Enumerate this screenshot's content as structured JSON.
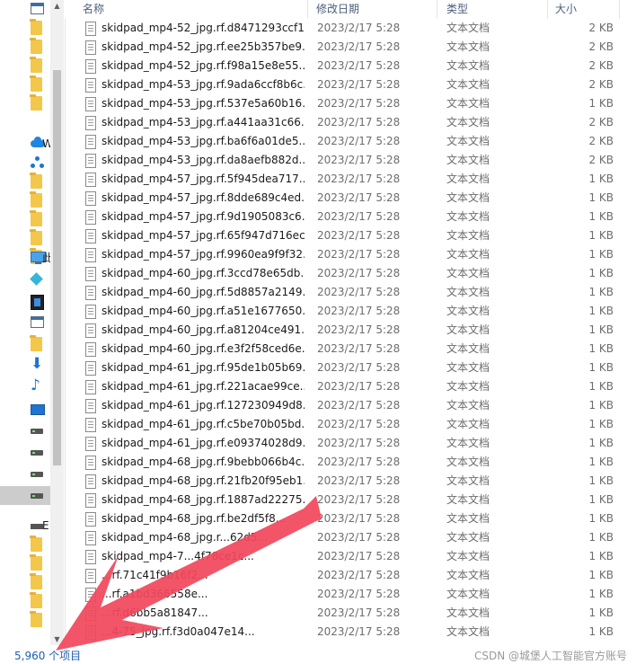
{
  "header": {
    "col_name": "名称",
    "col_date": "修改日期",
    "col_type": "类型",
    "col_size": "大小"
  },
  "nav": {
    "items": [
      {
        "icon": "window-icon",
        "label": ""
      },
      {
        "icon": "folder-icon",
        "label": ""
      },
      {
        "icon": "folder-icon",
        "label": ""
      },
      {
        "icon": "folder-icon",
        "label": ""
      },
      {
        "icon": "folder-icon",
        "label": ""
      },
      {
        "icon": "folder-icon",
        "label": ""
      },
      {
        "icon": "onedrive-icon",
        "label": "W"
      },
      {
        "icon": "network-nodes-icon",
        "label": ""
      },
      {
        "icon": "folder-icon",
        "label": ""
      },
      {
        "icon": "folder-icon",
        "label": ""
      },
      {
        "icon": "folder-icon",
        "label": ""
      },
      {
        "icon": "folder-icon",
        "label": ""
      },
      {
        "icon": "folder-icon",
        "label": ""
      },
      {
        "icon": "this-pc-icon",
        "label": "此"
      },
      {
        "icon": "3d-objects-icon",
        "label": ""
      },
      {
        "icon": "videos-icon",
        "label": ""
      },
      {
        "icon": "pictures-icon",
        "label": ""
      },
      {
        "icon": "documents-icon",
        "label": ""
      },
      {
        "icon": "downloads-icon",
        "label": ""
      },
      {
        "icon": "music-icon",
        "label": ""
      },
      {
        "icon": "desktop-icon",
        "label": ""
      },
      {
        "icon": "windows-drive-icon",
        "label": ""
      },
      {
        "icon": "drive-icon",
        "label": ""
      },
      {
        "icon": "drive-icon",
        "label": ""
      },
      {
        "icon": "drive-icon",
        "label": ""
      },
      {
        "icon": "spacer",
        "label": ""
      },
      {
        "icon": "network-drive-icon",
        "label": "E"
      },
      {
        "icon": "folder-icon",
        "label": ""
      },
      {
        "icon": "folder-icon",
        "label": ""
      },
      {
        "icon": "folder-icon",
        "label": ""
      },
      {
        "icon": "folder-icon",
        "label": ""
      },
      {
        "icon": "folder-icon",
        "label": ""
      }
    ]
  },
  "files": [
    {
      "name": "skidpad_mp4-52_jpg.rf.d8471293ccf1...",
      "date": "2023/2/17 5:28",
      "type": "文本文档",
      "size": "2 KB"
    },
    {
      "name": "skidpad_mp4-52_jpg.rf.ee25b357be9...",
      "date": "2023/2/17 5:28",
      "type": "文本文档",
      "size": "2 KB"
    },
    {
      "name": "skidpad_mp4-52_jpg.rf.f98a15e8e55...",
      "date": "2023/2/17 5:28",
      "type": "文本文档",
      "size": "2 KB"
    },
    {
      "name": "skidpad_mp4-53_jpg.rf.9ada6ccf8b6c...",
      "date": "2023/2/17 5:28",
      "type": "文本文档",
      "size": "2 KB"
    },
    {
      "name": "skidpad_mp4-53_jpg.rf.537e5a60b16...",
      "date": "2023/2/17 5:28",
      "type": "文本文档",
      "size": "1 KB"
    },
    {
      "name": "skidpad_mp4-53_jpg.rf.a441aa31c66...",
      "date": "2023/2/17 5:28",
      "type": "文本文档",
      "size": "2 KB"
    },
    {
      "name": "skidpad_mp4-53_jpg.rf.ba6f6a01de5...",
      "date": "2023/2/17 5:28",
      "type": "文本文档",
      "size": "2 KB"
    },
    {
      "name": "skidpad_mp4-53_jpg.rf.da8aefb882d...",
      "date": "2023/2/17 5:28",
      "type": "文本文档",
      "size": "2 KB"
    },
    {
      "name": "skidpad_mp4-57_jpg.rf.5f945dea717...",
      "date": "2023/2/17 5:28",
      "type": "文本文档",
      "size": "1 KB"
    },
    {
      "name": "skidpad_mp4-57_jpg.rf.8dde689c4ed...",
      "date": "2023/2/17 5:28",
      "type": "文本文档",
      "size": "1 KB"
    },
    {
      "name": "skidpad_mp4-57_jpg.rf.9d1905083c6...",
      "date": "2023/2/17 5:28",
      "type": "文本文档",
      "size": "1 KB"
    },
    {
      "name": "skidpad_mp4-57_jpg.rf.65f947d716ec...",
      "date": "2023/2/17 5:28",
      "type": "文本文档",
      "size": "1 KB"
    },
    {
      "name": "skidpad_mp4-57_jpg.rf.9960ea9f9f32...",
      "date": "2023/2/17 5:28",
      "type": "文本文档",
      "size": "1 KB"
    },
    {
      "name": "skidpad_mp4-60_jpg.rf.3ccd78e65db...",
      "date": "2023/2/17 5:28",
      "type": "文本文档",
      "size": "1 KB"
    },
    {
      "name": "skidpad_mp4-60_jpg.rf.5d8857a2149...",
      "date": "2023/2/17 5:28",
      "type": "文本文档",
      "size": "1 KB"
    },
    {
      "name": "skidpad_mp4-60_jpg.rf.a51e1677650...",
      "date": "2023/2/17 5:28",
      "type": "文本文档",
      "size": "1 KB"
    },
    {
      "name": "skidpad_mp4-60_jpg.rf.a81204ce491...",
      "date": "2023/2/17 5:28",
      "type": "文本文档",
      "size": "1 KB"
    },
    {
      "name": "skidpad_mp4-60_jpg.rf.e3f2f58ced6e...",
      "date": "2023/2/17 5:28",
      "type": "文本文档",
      "size": "1 KB"
    },
    {
      "name": "skidpad_mp4-61_jpg.rf.95de1b05b69...",
      "date": "2023/2/17 5:28",
      "type": "文本文档",
      "size": "1 KB"
    },
    {
      "name": "skidpad_mp4-61_jpg.rf.221acae99ce...",
      "date": "2023/2/17 5:28",
      "type": "文本文档",
      "size": "1 KB"
    },
    {
      "name": "skidpad_mp4-61_jpg.rf.127230949d8...",
      "date": "2023/2/17 5:28",
      "type": "文本文档",
      "size": "1 KB"
    },
    {
      "name": "skidpad_mp4-61_jpg.rf.c5be70b05bd...",
      "date": "2023/2/17 5:28",
      "type": "文本文档",
      "size": "1 KB"
    },
    {
      "name": "skidpad_mp4-61_jpg.rf.e09374028d9...",
      "date": "2023/2/17 5:28",
      "type": "文本文档",
      "size": "1 KB"
    },
    {
      "name": "skidpad_mp4-68_jpg.rf.9bebb066b4c...",
      "date": "2023/2/17 5:28",
      "type": "文本文档",
      "size": "1 KB"
    },
    {
      "name": "skidpad_mp4-68_jpg.rf.21fb20f95eb1...",
      "date": "2023/2/17 5:28",
      "type": "文本文档",
      "size": "1 KB"
    },
    {
      "name": "skidpad_mp4-68_jpg.rf.1887ad22275...",
      "date": "2023/2/17 5:28",
      "type": "文本文档",
      "size": "1 KB"
    },
    {
      "name": "skidpad_mp4-68_jpg.rf.be2df5f8...",
      "date": "2023/2/17 5:28",
      "type": "文本文档",
      "size": "1 KB"
    },
    {
      "name": "skidpad_mp4-68_jpg.r...62d5...",
      "date": "2023/2/17 5:28",
      "type": "文本文档",
      "size": "1 KB"
    },
    {
      "name": "skidpad_mp4-7...4f78ce1c...",
      "date": "2023/2/17 5:28",
      "type": "文本文档",
      "size": "1 KB"
    },
    {
      "name": "...rf.71c41f9b16f2...",
      "date": "2023/2/17 5:28",
      "type": "文本文档",
      "size": "1 KB"
    },
    {
      "name": "...rf.a1bd366558e...",
      "date": "2023/2/17 5:28",
      "type": "文本文档",
      "size": "1 KB"
    },
    {
      "name": "...rf.d6bb5a81847...",
      "date": "2023/2/17 5:28",
      "type": "文本文档",
      "size": "1 KB"
    },
    {
      "name": "...4-75_jpg.rf.f3d0a047e14...",
      "date": "2023/2/17 5:28",
      "type": "文本文档",
      "size": "1 KB"
    }
  ],
  "status": {
    "item_count": "5,960 个项目"
  },
  "watermark": "CSDN @城堡人工智能官方账号",
  "colors": {
    "accent_arrow": "#f2485c",
    "status_text": "#1e5fae",
    "nav_selected": "#cccccc",
    "folder": "#f3c74a"
  }
}
